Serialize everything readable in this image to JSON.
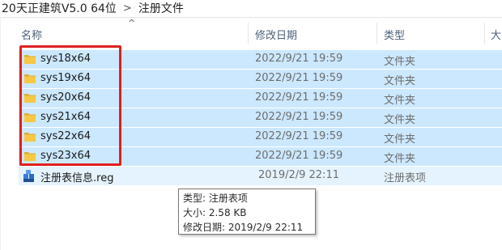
{
  "breadcrumb": {
    "parent": "20天正建筑V5.0 64位",
    "separator": ">",
    "current": "注册文件"
  },
  "columns": {
    "name": "名称",
    "date": "修改日期",
    "type": "类型",
    "size": "大"
  },
  "sort_indicator": "^",
  "rows": [
    {
      "name": "sys18x64",
      "date": "2022/9/21 19:59",
      "type": "文件夹",
      "icon": "folder-icon",
      "selected": true
    },
    {
      "name": "sys19x64",
      "date": "2022/9/21 19:59",
      "type": "文件夹",
      "icon": "folder-icon",
      "selected": true
    },
    {
      "name": "sys20x64",
      "date": "2022/9/21 19:59",
      "type": "文件夹",
      "icon": "folder-icon",
      "selected": true
    },
    {
      "name": "sys21x64",
      "date": "2022/9/21 19:59",
      "type": "文件夹",
      "icon": "folder-icon",
      "selected": true
    },
    {
      "name": "sys22x64",
      "date": "2022/9/21 19:59",
      "type": "文件夹",
      "icon": "folder-icon",
      "selected": true
    },
    {
      "name": "sys23x64",
      "date": "2022/9/21 19:59",
      "type": "文件夹",
      "icon": "folder-icon",
      "selected": true
    },
    {
      "name": "注册表信息.reg",
      "date": "2019/2/9 22:11",
      "type": "注册表项",
      "icon": "registry-file-icon",
      "selected": false
    }
  ],
  "tooltip": {
    "type_line": "类型: 注册表项",
    "size_line": "大小: 2.58 KB",
    "date_line": "修改日期: 2019/2/9 22:11"
  },
  "colors": {
    "selection": "#cce8ff",
    "highlight_box": "#e02020",
    "folder": "#f7c844",
    "header_text": "#4c607a"
  }
}
